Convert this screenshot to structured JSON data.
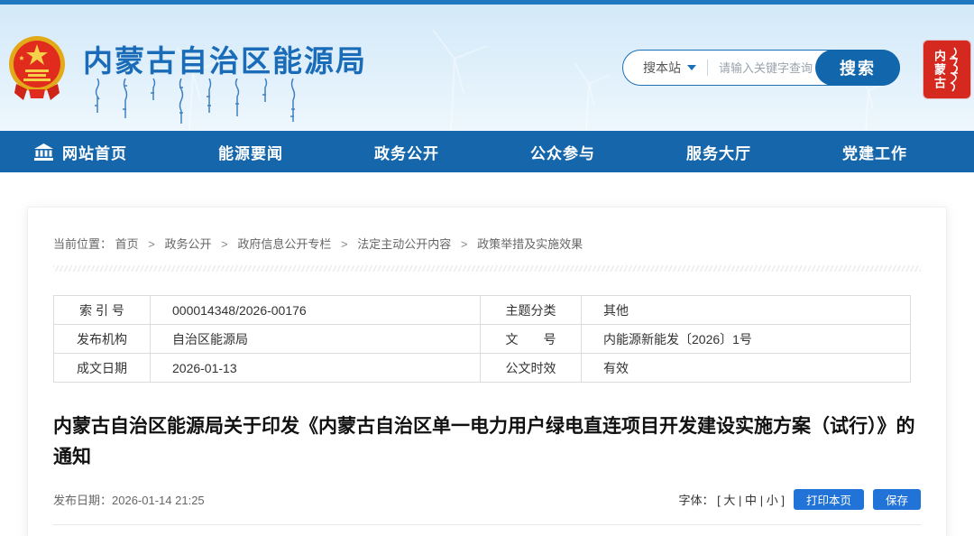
{
  "header": {
    "site_title": "内蒙古自治区能源局",
    "search": {
      "scope_label": "搜本站",
      "placeholder": "请输入关键字查询",
      "button_label": "搜索"
    },
    "seal_text": "内蒙古"
  },
  "nav": {
    "items": [
      {
        "label": "网站首页"
      },
      {
        "label": "能源要闻"
      },
      {
        "label": "政务公开"
      },
      {
        "label": "公众参与"
      },
      {
        "label": "服务大厅"
      },
      {
        "label": "党建工作"
      }
    ]
  },
  "breadcrumb": {
    "prefix": "当前位置：",
    "separator": ">",
    "items": [
      "首页",
      "政务公开",
      "政府信息公开专栏",
      "法定主动公开内容",
      "政策举措及实施效果"
    ]
  },
  "doc_info": {
    "rows": [
      {
        "label1": "索 引 号",
        "value1": "000014348/2026-00176",
        "label2": "主题分类",
        "value2": "其他"
      },
      {
        "label1": "发布机构",
        "value1": "自治区能源局",
        "label2": "文　　号",
        "value2": "内能源新能发〔2026〕1号"
      },
      {
        "label1": "成文日期",
        "value1": "2026-01-13",
        "label2": "公文时效",
        "value2": "有效"
      }
    ]
  },
  "article": {
    "title": "内蒙古自治区能源局关于印发《内蒙古自治区单一电力用户绿电直连项目开发建设实施方案（试行）》的通知",
    "publish_label": "发布日期：",
    "publish_date": "2026-01-14 21:25",
    "font_size_label": "字体：",
    "font_size_open": "[",
    "font_size_close": "]",
    "font_size_pipe": "|",
    "font_sizes": [
      "大",
      "中",
      "小"
    ],
    "print_button": "打印本页",
    "save_button": "保存"
  },
  "colors": {
    "nav_blue": "#1566ab",
    "top_strip_blue": "#1f78bf",
    "brand_blue": "#1b6cb8",
    "action_button_blue": "#2273d7",
    "seal_red": "#d5281e"
  }
}
